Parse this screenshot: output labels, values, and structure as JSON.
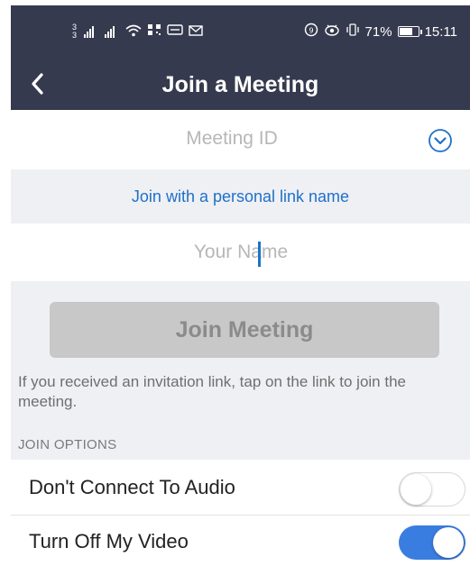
{
  "status_bar": {
    "sim_slots": [
      "3",
      "3"
    ],
    "battery": "71%",
    "time": "15:11"
  },
  "header": {
    "title": "Join a Meeting",
    "back_icon": "chevron-left-icon"
  },
  "meeting_id": {
    "placeholder": "Meeting ID",
    "value": "",
    "dropdown_icon": "chevron-down-circle-icon"
  },
  "personal_link": {
    "label": "Join with a personal link name"
  },
  "name_field": {
    "placeholder": "Your Name",
    "value": ""
  },
  "join_button": {
    "label": "Join Meeting",
    "enabled": false
  },
  "hint": {
    "text": "If you received an invitation link, tap on the link to join the meeting."
  },
  "options": {
    "section_label": "JOIN OPTIONS",
    "items": [
      {
        "label": "Don't Connect To Audio",
        "on": false
      },
      {
        "label": "Turn Off My Video",
        "on": true
      }
    ]
  },
  "colors": {
    "header_bg": "#363a4e",
    "accent": "#1f70c9",
    "toggle_on": "#3a7de0",
    "section_bg": "#eff0f4"
  }
}
